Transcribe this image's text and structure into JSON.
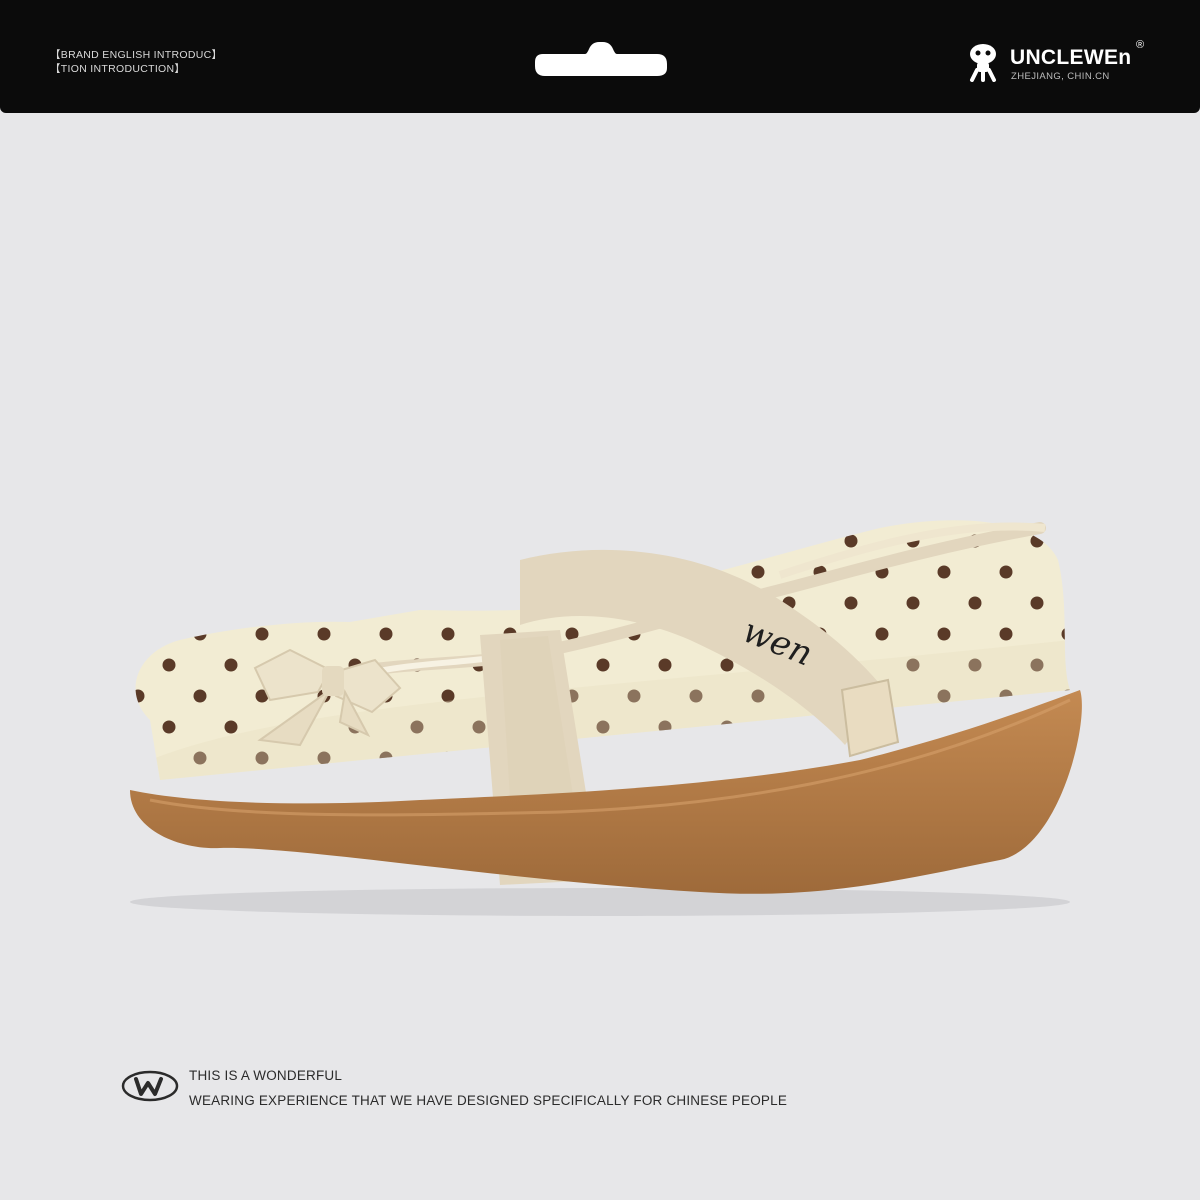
{
  "header": {
    "intro_line_1": "【BRAND ENGLISH INTRODUC】",
    "intro_line_2": "【TION INTRODUCTION】",
    "brand_name": "UNCLEWEn",
    "registered_mark": "®",
    "brand_location": "ZHEJIANG, CHIN.CN",
    "logo_icon": "mushroom-character-icon"
  },
  "product": {
    "image_subject": "shoe-photo",
    "strap_embroidery": "wen"
  },
  "footer": {
    "logo_icon": "w-oval-logo-icon",
    "tagline_1": "THIS IS A WONDERFUL",
    "tagline_2": "WEARING EXPERIENCE THAT WE HAVE DESIGNED SPECIFICALLY FOR CHINESE PEOPLE"
  },
  "colors": {
    "background": "#e7e7e9",
    "header_bar": "#0b0b0b",
    "shoe_upper": "#f2ecd3",
    "polka_dot": "#5a3a28",
    "sole": "#b17b46",
    "strap": "#e2d6be"
  }
}
